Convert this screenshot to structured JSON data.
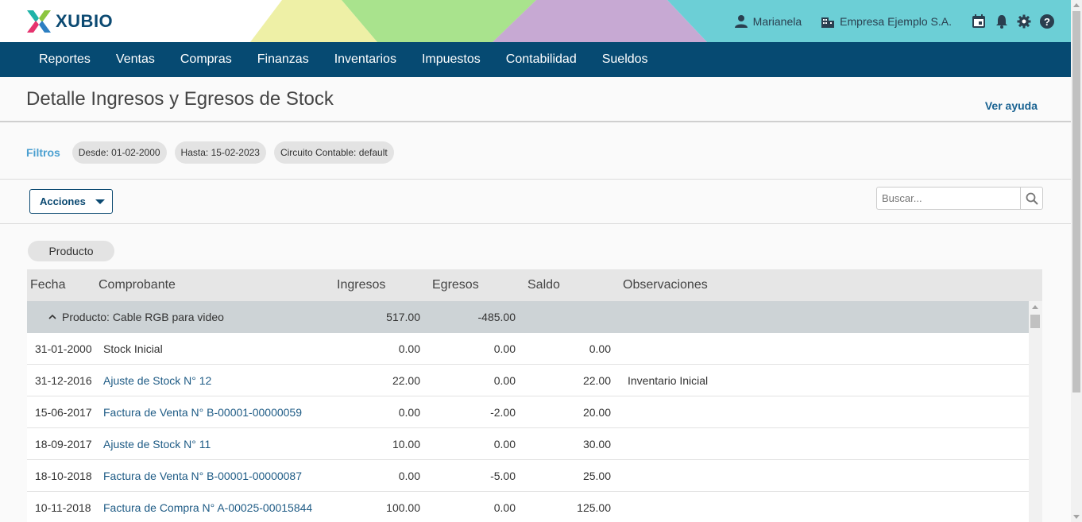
{
  "app": {
    "brand": "XUBIO",
    "user": "Marianela",
    "company": "Empresa Ejemplo S.A.",
    "icons": [
      "calendar-icon",
      "bell-icon",
      "gear-icon",
      "help-icon"
    ]
  },
  "nav": {
    "items": [
      "Reportes",
      "Ventas",
      "Compras",
      "Finanzas",
      "Inventarios",
      "Impuestos",
      "Contabilidad",
      "Sueldos"
    ]
  },
  "page": {
    "title": "Detalle Ingresos y Egresos de Stock",
    "help": "Ver ayuda"
  },
  "filters": {
    "label": "Filtros",
    "chips": [
      {
        "key": "Desde:",
        "value": "01-02-2000"
      },
      {
        "key": "Hasta:",
        "value": "15-02-2023"
      },
      {
        "key": "Circuito Contable:",
        "value": "default"
      }
    ]
  },
  "toolbar": {
    "actions_label": "Acciones",
    "search_placeholder": "Buscar..."
  },
  "grouping": {
    "chip": "Producto"
  },
  "table": {
    "columns": [
      "Fecha",
      "Comprobante",
      "Ingresos",
      "Egresos",
      "Saldo",
      "Observaciones"
    ],
    "group": {
      "label": "Producto: Cable RGB para video",
      "ingresos": "517.00",
      "egresos": "-485.00"
    },
    "rows": [
      {
        "fecha": "31-01-2000",
        "comprobante": "Stock Inicial",
        "ingresos": "0.00",
        "egresos": "0.00",
        "saldo": "0.00",
        "observaciones": ""
      },
      {
        "fecha": "31-12-2016",
        "comprobante": "Ajuste de Stock N° 12",
        "ingresos": "22.00",
        "egresos": "0.00",
        "saldo": "22.00",
        "observaciones": "Inventario Inicial"
      },
      {
        "fecha": "15-06-2017",
        "comprobante": "Factura de Venta N° B-00001-00000059",
        "ingresos": "0.00",
        "egresos": "-2.00",
        "saldo": "20.00",
        "observaciones": ""
      },
      {
        "fecha": "18-09-2017",
        "comprobante": "Ajuste de Stock N° 11",
        "ingresos": "10.00",
        "egresos": "0.00",
        "saldo": "30.00",
        "observaciones": ""
      },
      {
        "fecha": "18-10-2018",
        "comprobante": "Factura de Venta N° B-00001-00000087",
        "ingresos": "0.00",
        "egresos": "-5.00",
        "saldo": "25.00",
        "observaciones": ""
      },
      {
        "fecha": "10-11-2018",
        "comprobante": "Factura de Compra N° A-00025-00015844",
        "ingresos": "100.00",
        "egresos": "0.00",
        "saldo": "125.00",
        "observaciones": ""
      }
    ]
  },
  "colors": {
    "nav_bg": "#064a72",
    "link": "#1e5b85",
    "group_row_bg": "#cdd3d6",
    "header_bg": "#e6e6e6"
  }
}
